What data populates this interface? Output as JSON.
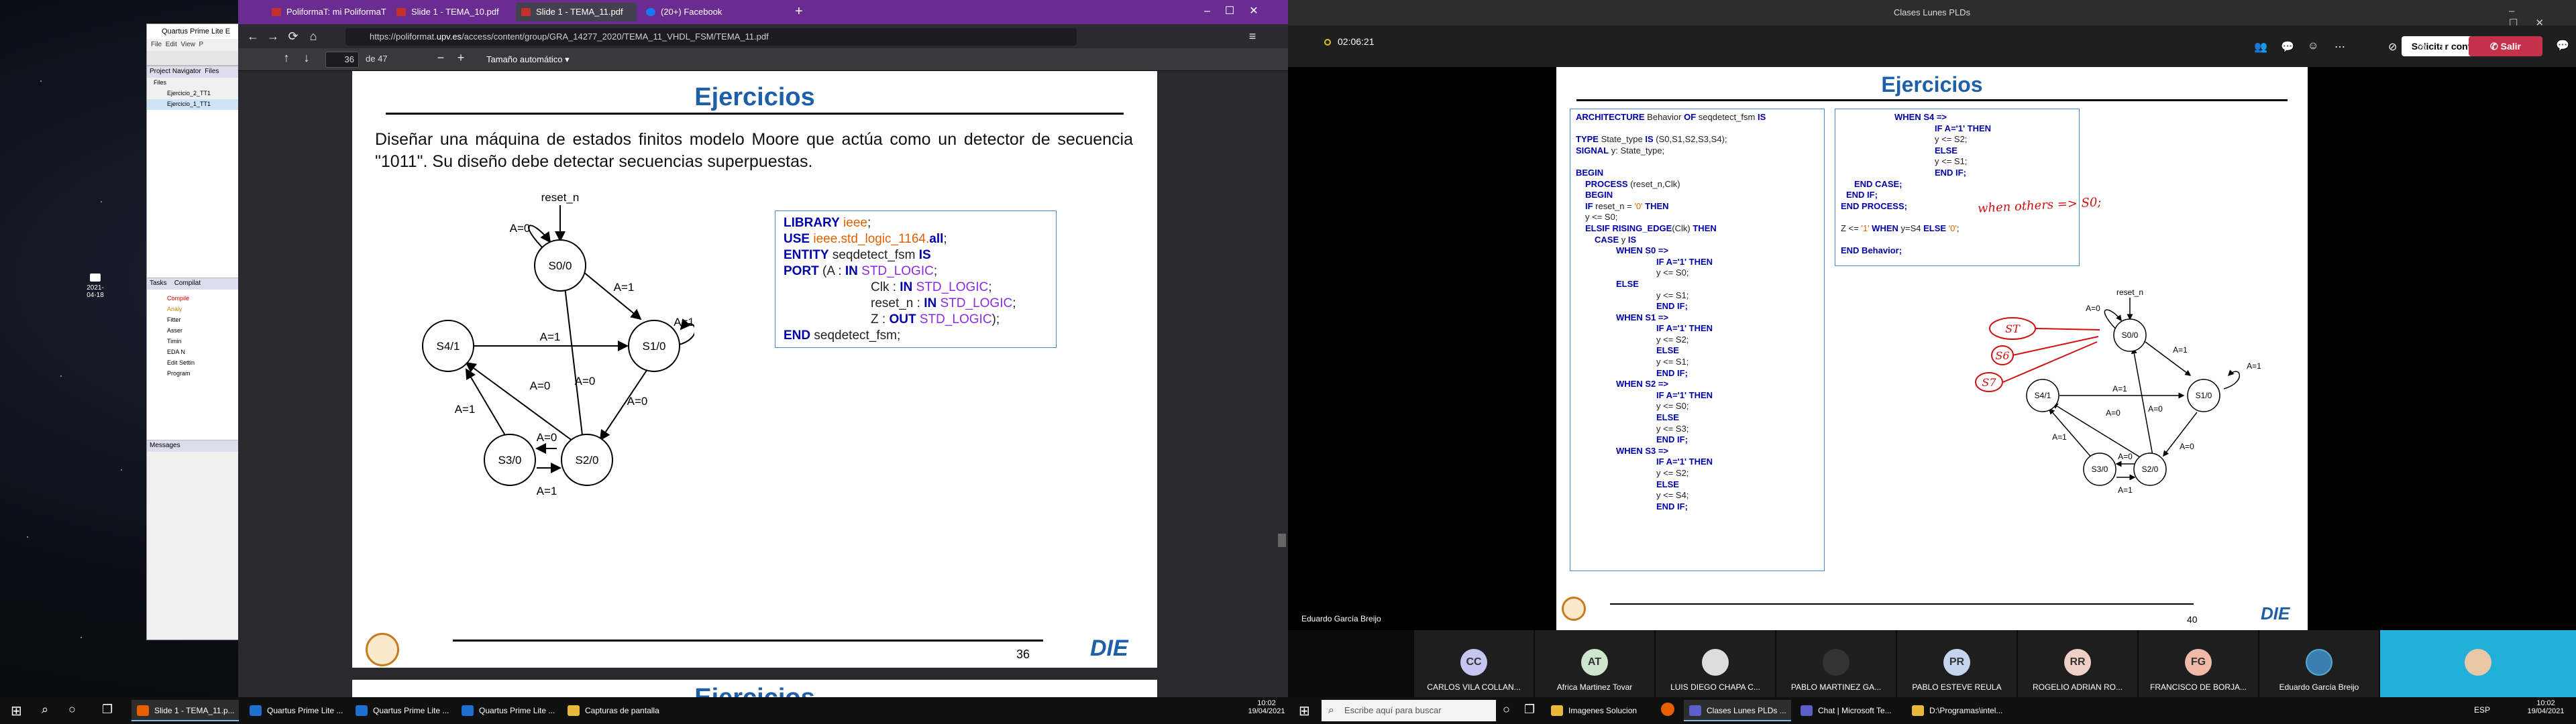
{
  "left_screen": {
    "desktop": {
      "date_label": "2021-04-18"
    },
    "quartus": {
      "title": "Quartus Prime Lite E",
      "menu": [
        "File",
        "Edit",
        "View",
        "P"
      ],
      "project_navigator": "Project Navigator",
      "files_tab": "Files",
      "files_header": "Files",
      "files": [
        "Ejercicio_2_TT1",
        "Ejercicio_1_TT1"
      ],
      "tasks_header": "Tasks",
      "compilation_tab": "Compilat",
      "tasks": [
        "Compile",
        "Analy",
        "Fitter",
        "Asser",
        "Timin",
        "EDA N",
        "Edit Settin",
        "Program"
      ],
      "messages": "Messages"
    },
    "browser": {
      "tabs": [
        {
          "label": "PoliformaT: mi PoliformaT - M",
          "active": false
        },
        {
          "label": "Slide 1 - TEMA_10.pdf",
          "active": false
        },
        {
          "label": "Slide 1 - TEMA_11.pdf",
          "active": true
        },
        {
          "label": "(20+) Facebook",
          "active": false
        }
      ],
      "url_prefix": "https://poliformat.",
      "url_domain": "upv.es",
      "url_suffix": "/access/content/group/GRA_14277_2020/TEMA_11_VHDL_FSM/TEMA_11.pdf",
      "page_number": "36",
      "page_of": "de 47",
      "zoom": "Tamaño automático"
    },
    "slide36": {
      "title": "Ejercicios",
      "statement": "Diseñar una máquina de estados finitos modelo Moore que actúa como un detector de secuencia \"1011\". Su diseño debe detectar secuencias superpuestas.",
      "page": "36",
      "reset_label": "reset_n",
      "states": [
        "S0/0",
        "S1/0",
        "S2/0",
        "S3/0",
        "S4/1"
      ],
      "edges": [
        "A=0",
        "A=1",
        "A=1",
        "A=0",
        "A=0",
        "A=1",
        "A=0",
        "A=0",
        "A=1",
        "A=1"
      ],
      "code": {
        "l1_kw": "LIBRARY",
        "l1_name": "ieee",
        "l1_end": ";",
        "l2_kw": "USE",
        "l2_a": "ieee",
        "l2_b": ".std_logic_1164.",
        "l2_c": "all",
        "l2_end": ";",
        "l3_kw": "ENTITY",
        "l3_name": " seqdetect_fsm ",
        "l3_kw2": "IS",
        "l4_kw": "PORT",
        "l4_a": " (A : ",
        "l4_in": "IN",
        "l4_ty": "STD_LOGIC",
        "l4_end": ";",
        "l5_a": "Clk : ",
        "l5_in": "IN",
        "l5_ty": "STD_LOGIC",
        "l5_end": ";",
        "l6_a": "reset_n : ",
        "l6_in": "IN",
        "l6_ty": "STD_LOGIC",
        "l6_end": ";",
        "l7_a": "Z : ",
        "l7_out": "OUT",
        "l7_ty": "STD_LOGIC",
        "l7_end": ");",
        "l8_kw": "END",
        "l8_name": " seqdetect_fsm;"
      },
      "next_title": "Ejercicios"
    },
    "taskbar": {
      "items": [
        "Slide 1 - TEMA_11.p...",
        "Quartus Prime Lite ...",
        "Quartus Prime Lite ...",
        "Quartus Prime Lite ...",
        "Capturas de pantalla"
      ],
      "time": "10:02",
      "date": "19/04/2021"
    }
  },
  "right_screen": {
    "window_title": "Clases Lunes PLDs",
    "timer": "02:06:21",
    "request_control": "Solicitar control",
    "leave": "Salir",
    "presenter": "Eduardo García Breijo",
    "slide40": {
      "title": "Ejercicios",
      "page": "40",
      "arch": {
        "a1_kw": "ARCHITECTURE",
        "a1_name": " Behavior ",
        "a1_of": "OF",
        "a1_ent": " seqdetect_fsm ",
        "a1_is": "IS",
        "a2_kw": "TYPE",
        "a2_name": " State_type ",
        "a2_is": "IS",
        "a2_vals": " (S0,S1,S2,S3,S4);",
        "a3_kw": "SIGNAL",
        "a3_name": " y: State_type;",
        "a4": "BEGIN",
        "a5_kw": "PROCESS",
        "a5_rest": " (reset_n,Clk)",
        "a6": "BEGIN",
        "a7_kw": "IF",
        "a7_mid": " reset_n = ",
        "a7_val": "'0'",
        "a7_then": " THEN",
        "a8": "y <= S0;",
        "a9_kw": "ELSIF",
        "a9_fn": " RISING_EDGE",
        "a9_mid": "(Clk) ",
        "a9_then": "THEN",
        "a10_kw": "CASE",
        "a10_rest": " y ",
        "a10_is": "IS",
        "s0": "WHEN S0 =>",
        "if0": "IF A='1' THEN",
        "y0a": "y <= S0;",
        "else": "ELSE",
        "y0b": "y <= S1;",
        "endif": "END IF;",
        "s1": "WHEN S1 =>",
        "if1": "IF A='1' THEN",
        "y1a": "y <= S2;",
        "y1b": "y <= S1;",
        "s2": "WHEN S2 =>",
        "if2": "IF A='1' THEN",
        "y2a": "y <= S0;",
        "y2b": "y <= S3;",
        "s3": "WHEN S3 =>",
        "if3": "IF A='1' THEN",
        "y3a": "y <= S2;",
        "y3b": "y <= S4;"
      },
      "arch2": {
        "s4": "WHEN S4 =>",
        "if4": "IF A='1' THEN",
        "y4a": "y <= S2;",
        "else": "ELSE",
        "y4b": "y <= S1;",
        "endif": "END IF;",
        "endcase": "END CASE;",
        "endif2": "END IF;",
        "endproc": "END PROCESS;",
        "z_a": "Z <= ",
        "z_one": "'1'",
        "z_when": " WHEN ",
        "z_cond": "y=S4 ",
        "z_else": "ELSE ",
        "z_zero": "'0'",
        "z_end": ";",
        "endb": "END Behavior;"
      },
      "annotations": [
        "when others => S0;",
        "ST",
        "S6",
        "S7"
      ],
      "reset_label": "reset_n",
      "states": [
        "S0/0",
        "S1/0",
        "S2/0",
        "S3/0",
        "S4/1"
      ],
      "edges": [
        "A=0",
        "A=1",
        "A=1",
        "A=0",
        "A=0",
        "A=1",
        "A=0",
        "A=0",
        "A=1",
        "A=1"
      ]
    },
    "participants": [
      {
        "initials": "CC",
        "name": "CARLOS VILA COLLAN...",
        "color": "#c6c6f0"
      },
      {
        "initials": "AT",
        "name": "Africa Martinez Tovar",
        "color": "#cde6cd"
      },
      {
        "initials": "",
        "name": "LUIS DIEGO CHAPA C...",
        "color": "#dddddd"
      },
      {
        "initials": "",
        "name": "PABLO MARTINEZ GA...",
        "color": "#333333"
      },
      {
        "initials": "PR",
        "name": "PABLO ESTEVE REULA",
        "color": "#c6d4ee"
      },
      {
        "initials": "RR",
        "name": "ROGELIO ADRIAN RO...",
        "color": "#eed0c6"
      },
      {
        "initials": "FG",
        "name": "FRANCISCO DE BORJA...",
        "color": "#f0b9a8"
      },
      {
        "initials": "",
        "name": "Eduardo García Breijo",
        "color": "#3a7fb0"
      }
    ],
    "taskbar": {
      "search_placeholder": "Escribe aquí para buscar",
      "items": [
        "Imagenes Solucion",
        "Clases Lunes PLDs ...",
        "Chat | Microsoft Te...",
        "D:\\Programas\\intel..."
      ],
      "lang": "ESP",
      "time": "10:02",
      "date": "19/04/2021"
    }
  }
}
